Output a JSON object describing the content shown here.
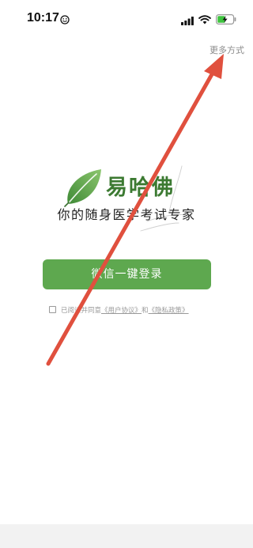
{
  "status_bar": {
    "time": "10:17",
    "face_icon": "smiley-face-icon",
    "signal_icon": "cellular-signal-icon",
    "wifi_icon": "wifi-icon",
    "battery_icon": "battery-charging-icon",
    "battery_level": 0.5
  },
  "header": {
    "more_methods": "更多方式"
  },
  "brand": {
    "logo_icon": "leaf-icon",
    "name": "易哈佛",
    "slogan": "你的随身医学考试专家",
    "color": "#3c7a32"
  },
  "login": {
    "wechat_button": "微信一键登录",
    "button_color": "#5ea84f"
  },
  "agreement": {
    "checked": false,
    "prefix": "已阅读并同意",
    "user_agreement": "《用户协议》",
    "conjunction": "和",
    "privacy_policy": "《隐私政策》"
  },
  "annotation": {
    "arrow_color": "#e0503e"
  }
}
